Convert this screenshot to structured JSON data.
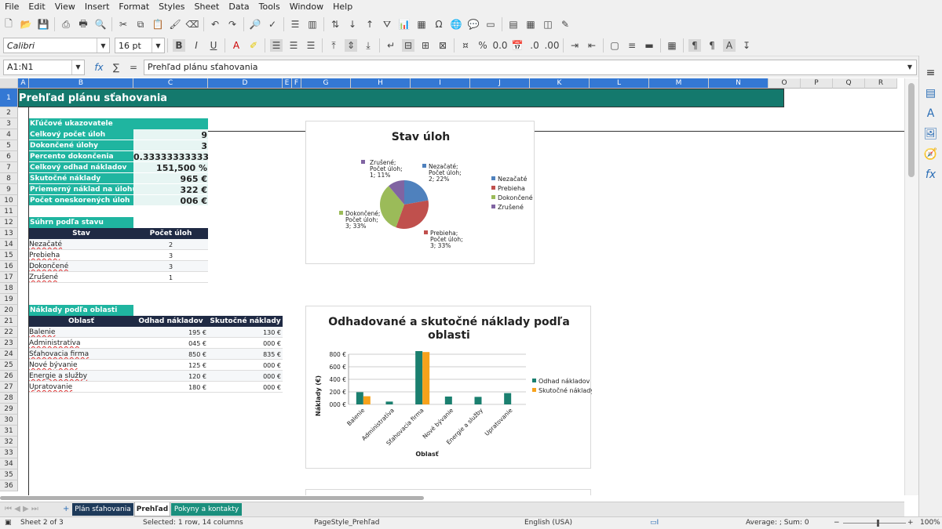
{
  "menu": [
    "File",
    "Edit",
    "View",
    "Insert",
    "Format",
    "Styles",
    "Sheet",
    "Data",
    "Tools",
    "Window",
    "Help"
  ],
  "font": {
    "name": "Calibri",
    "size": "16 pt"
  },
  "formula": {
    "cellref": "A1:N1",
    "fx": "fx",
    "sigma": "∑",
    "eq": "=",
    "content": "Prehľad plánu sťahovania"
  },
  "columns": [
    "A",
    "B",
    "C",
    "D",
    "E",
    "F",
    "G",
    "H",
    "I",
    "J",
    "K",
    "L",
    "M",
    "N",
    "O",
    "P",
    "Q",
    "R"
  ],
  "rows": [
    "1",
    "2",
    "3",
    "4",
    "5",
    "6",
    "7",
    "8",
    "9",
    "10",
    "11",
    "12",
    "13",
    "14",
    "15",
    "16",
    "17",
    "18",
    "19",
    "20",
    "21",
    "22",
    "23",
    "24",
    "25",
    "26",
    "27",
    "28",
    "29",
    "30",
    "31",
    "32",
    "33",
    "34",
    "35",
    "36"
  ],
  "title": "Prehľad plánu sťahovania",
  "kpi": {
    "header": "Kľúčové ukazovatele",
    "rows": [
      {
        "label": "Celkový počet úloh",
        "value": "9"
      },
      {
        "label": "Dokončené úlohy",
        "value": "3"
      },
      {
        "label": "Percento dokončenia",
        "value": "0.333333333333"
      },
      {
        "label": "Celkový odhad nákladov",
        "value": "151,500 %"
      },
      {
        "label": "Skutočné náklady",
        "value": "965 €"
      },
      {
        "label": "Priemerný náklad na úlohu",
        "value": "322 €"
      },
      {
        "label": "Počet oneskorených úloh",
        "value": "006 €"
      }
    ]
  },
  "status_summary": {
    "header": "Súhrn podľa stavu",
    "col1": "Stav",
    "col2": "Počet úloh",
    "rows": [
      {
        "label": "Nezačaté",
        "value": "2"
      },
      {
        "label": "Prebieha",
        "value": "3"
      },
      {
        "label": "Dokončené",
        "value": "3"
      },
      {
        "label": "Zrušené",
        "value": "1"
      }
    ]
  },
  "costs": {
    "header": "Náklady podľa oblasti",
    "col1": "Oblasť",
    "col2": "Odhad nákladov",
    "col3": "Skutočné náklady",
    "rows": [
      {
        "label": "Balenie",
        "est": "195 €",
        "act": "130 €"
      },
      {
        "label": "Administratíva",
        "est": "045 €",
        "act": "000 €"
      },
      {
        "label": "Sťahovacia firma",
        "est": "850 €",
        "act": "835 €"
      },
      {
        "label": "Nové bývanie",
        "est": "125 €",
        "act": "000 €"
      },
      {
        "label": "Energie a služby",
        "est": "120 €",
        "act": "000 €"
      },
      {
        "label": "Upratovanie",
        "est": "180 €",
        "act": "000 €"
      }
    ]
  },
  "chart_data": [
    {
      "type": "pie",
      "title": "Stav úloh",
      "slices": [
        {
          "name": "Nezačaté",
          "value": 2,
          "pct": "22%",
          "color": "#4f81bd",
          "label": [
            "Nezačaté;",
            "Počet úloh;",
            "2; 22%"
          ]
        },
        {
          "name": "Prebieha",
          "value": 3,
          "pct": "33%",
          "color": "#c0504d",
          "label": [
            "Prebieha;",
            "Počet úloh;",
            "3; 33%"
          ]
        },
        {
          "name": "Dokončené",
          "value": 3,
          "pct": "33%",
          "color": "#9bbb59",
          "label": [
            "Dokončené;",
            "Počet úloh;",
            "3; 33%"
          ]
        },
        {
          "name": "Zrušené",
          "value": 1,
          "pct": "11%",
          "color": "#8064a2",
          "label": [
            "Zrušené;",
            "Počet úloh;",
            "1; 11%"
          ]
        }
      ],
      "legend": "right"
    },
    {
      "type": "bar",
      "title": "Odhadované a skutočné náklady podľa oblasti",
      "title_lines": [
        "Odhadované a skutočné náklady podľa",
        "oblasti"
      ],
      "xlabel": "Oblasť",
      "ylabel": "Náklady (€)",
      "ylim": [
        0,
        800
      ],
      "yticks": [
        "000 €",
        "200 €",
        "400 €",
        "600 €",
        "800 €"
      ],
      "categories": [
        "Balenie",
        "Administratíva",
        "Sťahovacia firma",
        "Nové bývanie",
        "Energie a služby",
        "Upratovanie"
      ],
      "series": [
        {
          "name": "Odhad nákladov",
          "color": "#1a7f6f",
          "values": [
            195,
            45,
            850,
            125,
            120,
            180
          ]
        },
        {
          "name": "Skutočné náklady",
          "color": "#f7a21b",
          "values": [
            130,
            0,
            835,
            0,
            0,
            0
          ]
        }
      ],
      "legend": "right"
    }
  ],
  "tabs": [
    "Plán sťahovania",
    "Prehľad",
    "Pokyny a kontakty"
  ],
  "status": {
    "sheet": "Sheet 2 of 3",
    "selected": "Selected: 1 row, 14 columns",
    "pagestyle": "PageStyle_Prehľad",
    "lang": "English (USA)",
    "sum": "Average: ; Sum: 0",
    "zoom": "100%"
  }
}
